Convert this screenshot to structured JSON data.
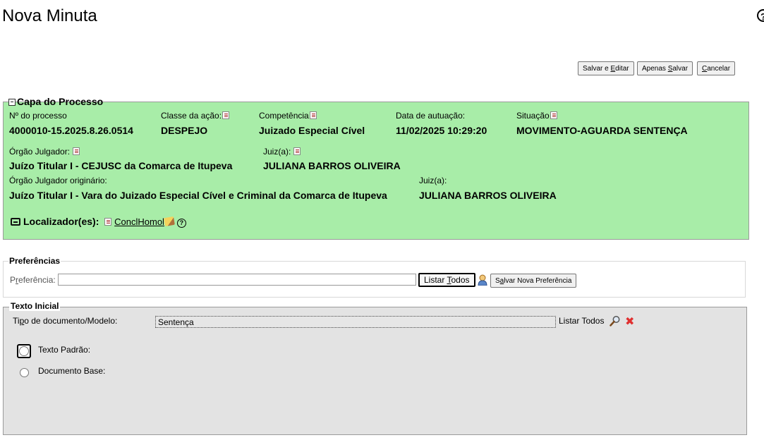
{
  "page": {
    "title": "Nova Minuta"
  },
  "toolbar": {
    "salvar_editar": {
      "pre": "Salvar e ",
      "u": "E",
      "post": "ditar"
    },
    "apenas_salvar": {
      "pre": "Apenas ",
      "u": "S",
      "post": "alvar"
    },
    "cancelar": {
      "pre": "",
      "u": "C",
      "post": "ancelar"
    }
  },
  "capa": {
    "legend": "Capa do Processo",
    "toggle": "−",
    "processo": {
      "label": "Nº do processo",
      "value": "4000010-15.2025.8.26.0514"
    },
    "classe": {
      "label": "Classe da ação:",
      "value": "DESPEJO"
    },
    "competencia": {
      "label": "Competência",
      "value": "Juizado Especial Cível"
    },
    "autuacao": {
      "label": "Data de autuação:",
      "value": "11/02/2025 10:29:20"
    },
    "situacao": {
      "label": "Situação",
      "value": "MOVIMENTO-AGUARDA SENTENÇA"
    },
    "orgao": {
      "label": "Órgão Julgador:",
      "value": "Juízo Titular I - CEJUSC da Comarca de Itupeva"
    },
    "juiz": {
      "label": "Juiz(a):",
      "value": "JULIANA BARROS OLIVEIRA"
    },
    "orgao_orig": {
      "label": "Órgão Julgador originário:",
      "value": "Juízo Titular I - Vara do Juizado Especial Cível e Criminal da Comarca de Itupeva"
    },
    "juiz_orig": {
      "label": "Juiz(a):",
      "value": "JULIANA BARROS OLIVEIRA"
    },
    "localizador": {
      "label": "Localizador(es):",
      "link": "ConclHomol",
      "help": "?"
    }
  },
  "preferencias": {
    "legend": "Preferências",
    "label_pre": "P",
    "label_u": "r",
    "label_post": "eferência:",
    "input_value": "",
    "listar_todos": {
      "pre": "Listar ",
      "u": "T",
      "post": "odos"
    },
    "salvar_nova": {
      "pre": "S",
      "u": "a",
      "post": "lvar Nova Preferência"
    }
  },
  "texto_inicial": {
    "legend": "Texto Inicial",
    "tipo_label_pre": "Ti",
    "tipo_label_u": "p",
    "tipo_label_post": "o de documento/Modelo:",
    "tipo_value": "Sentença",
    "listar_todos": "Listar Todos",
    "radio_padrao": "Texto Padrão:",
    "radio_base": "Documento Base:"
  },
  "header": {
    "help": "?"
  },
  "icons": [
    "help-icon",
    "toggle-icon",
    "list-icon",
    "locator-icon",
    "edit-icon",
    "user-icon",
    "magnify-icon",
    "delete-icon"
  ]
}
